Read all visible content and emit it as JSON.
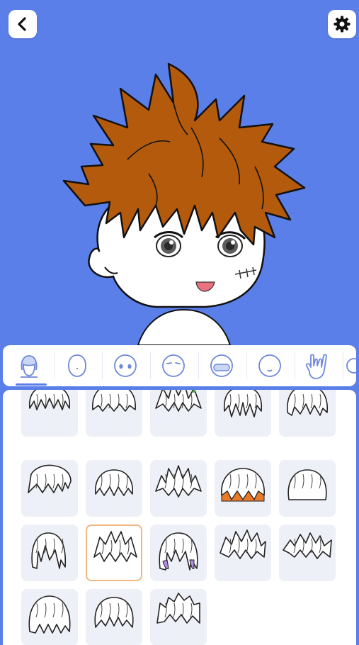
{
  "toolbar": {
    "back_icon": "back-arrow-icon",
    "settings_icon": "gear-icon"
  },
  "canvas": {
    "background_color": "#5B7FE8",
    "hair_color": "#B35A0D",
    "selected_hair_index": 11
  },
  "category_tabs": [
    {
      "icon": "hair-head-icon",
      "selected": true
    },
    {
      "icon": "face-shape-icon",
      "selected": false
    },
    {
      "icon": "eyes-icon",
      "selected": false
    },
    {
      "icon": "eyebrows-icon",
      "selected": false
    },
    {
      "icon": "mouth-mask-icon",
      "selected": false
    },
    {
      "icon": "face-icon",
      "selected": false
    },
    {
      "icon": "hand-gesture-icon",
      "selected": false
    },
    {
      "icon": "more-icon",
      "selected": false
    }
  ],
  "hair_options": [
    {
      "style": "messy-short",
      "accent": null
    },
    {
      "style": "wavy-fluffy",
      "accent": null
    },
    {
      "style": "spiky-green-tips",
      "accent": "#3DB83D"
    },
    {
      "style": "bun-bangs",
      "accent": null
    },
    {
      "style": "bob-bangs",
      "accent": null
    },
    {
      "style": "swept-back",
      "accent": null
    },
    {
      "style": "short-neat",
      "accent": null
    },
    {
      "style": "spiky-tall",
      "accent": null
    },
    {
      "style": "two-tone-orange",
      "accent": "#E87A2A"
    },
    {
      "style": "straight-bob",
      "accent": null
    },
    {
      "style": "long-straight",
      "accent": null
    },
    {
      "style": "messy-spiky",
      "accent": null
    },
    {
      "style": "long-purple-tips",
      "accent": "#B08AE0"
    },
    {
      "style": "spiky-side",
      "accent": null
    },
    {
      "style": "spiky-wide",
      "accent": null
    },
    {
      "style": "dreadlocks",
      "accent": null
    },
    {
      "style": "smooth-parted",
      "accent": null
    },
    {
      "style": "quiff",
      "accent": null
    }
  ]
}
